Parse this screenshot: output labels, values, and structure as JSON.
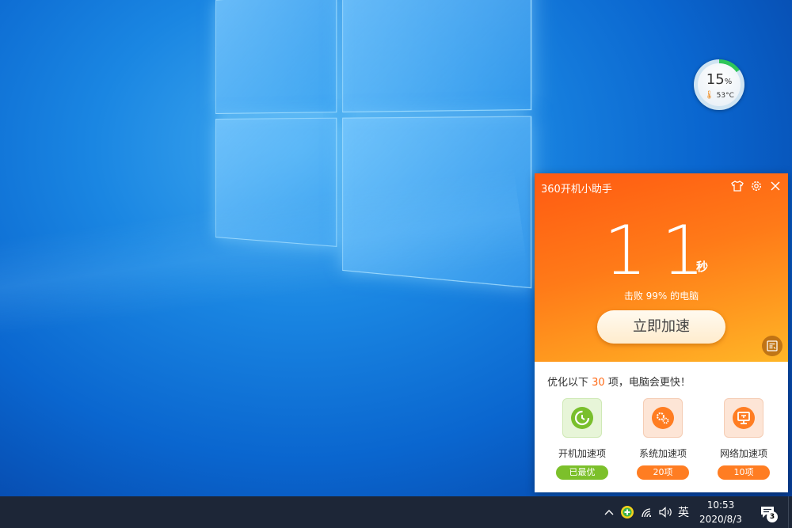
{
  "colors": {
    "accent_orange": "#ff7a18",
    "accent_green": "#7cc02b",
    "taskbar": "#1d2637",
    "cpu_ring": "#2fc65a"
  },
  "cpu_widget": {
    "usage_percent": 15,
    "usage_value": "15",
    "usage_unit": "%",
    "temperature": "53°C",
    "icon": "thermometer-icon"
  },
  "assistant": {
    "title": "360开机小助手",
    "header_icons": [
      "shirt-icon",
      "gear-icon",
      "close-icon"
    ],
    "boot_time": "11",
    "boot_unit": "秒",
    "beat_text": "击败 99% 的电脑",
    "speed_button": "立即加速",
    "corner_icon": "notes-icon",
    "optimize": {
      "prefix": "优化以下",
      "count": "30",
      "suffix": "项，电脑会更快！"
    },
    "items": [
      {
        "label": "开机加速项",
        "badge": "已最优",
        "icon": "power-clock-icon"
      },
      {
        "label": "系统加速项",
        "badge": "20项",
        "icon": "gears-icon"
      },
      {
        "label": "网络加速项",
        "badge": "10项",
        "icon": "network-monitor-icon"
      }
    ]
  },
  "taskbar": {
    "ime": "英",
    "time": "10:53",
    "date": "2020/8/3",
    "notifications": "3",
    "tray_icons": [
      "chevron-up-icon",
      "360-guard-icon",
      "wifi-icon",
      "volume-icon",
      "action-center-icon"
    ]
  }
}
